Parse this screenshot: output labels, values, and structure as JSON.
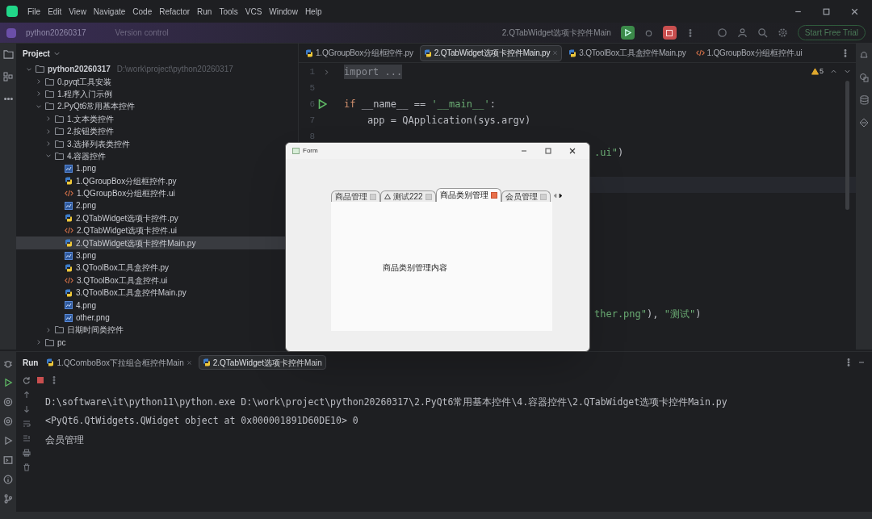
{
  "menu": [
    "File",
    "Edit",
    "View",
    "Navigate",
    "Code",
    "Refactor",
    "Run",
    "Tools",
    "VCS",
    "Window",
    "Help"
  ],
  "toolbar": {
    "project": "python20260317",
    "vcs": "Version control",
    "run_config": "2.QTabWidget选项卡控件Main",
    "trial": "Start Free Trial"
  },
  "project_panel": {
    "title": "Project",
    "tree": [
      {
        "label": "python20260317",
        "path": "D:\\work\\project\\python20260317",
        "kind": "folder",
        "expanded": true,
        "selected": false,
        "children": [
          {
            "label": "0.pyqt工具安装",
            "kind": "folder",
            "expanded": false,
            "selected": false
          },
          {
            "label": "1.程序入门示例",
            "kind": "folder",
            "expanded": false,
            "selected": false
          },
          {
            "label": "2.PyQt6常用基本控件",
            "kind": "folder",
            "expanded": true,
            "selected": false,
            "children": [
              {
                "label": "1.文本类控件",
                "kind": "folder",
                "expanded": false,
                "selected": false
              },
              {
                "label": "2.按钮类控件",
                "kind": "folder",
                "expanded": false,
                "selected": false
              },
              {
                "label": "3.选择列表类控件",
                "kind": "folder",
                "expanded": false,
                "selected": false
              },
              {
                "label": "4.容器控件",
                "kind": "folder",
                "expanded": true,
                "selected": false,
                "children": [
                  {
                    "label": "1.png",
                    "kind": "image",
                    "selected": false
                  },
                  {
                    "label": "1.QGroupBox分组框控件.py",
                    "kind": "python",
                    "selected": false
                  },
                  {
                    "label": "1.QGroupBox分组框控件.ui",
                    "kind": "ui",
                    "selected": false
                  },
                  {
                    "label": "2.png",
                    "kind": "image",
                    "selected": false
                  },
                  {
                    "label": "2.QTabWidget选项卡控件.py",
                    "kind": "python",
                    "selected": false
                  },
                  {
                    "label": "2.QTabWidget选项卡控件.ui",
                    "kind": "ui",
                    "selected": false
                  },
                  {
                    "label": "2.QTabWidget选项卡控件Main.py",
                    "kind": "python",
                    "selected": true
                  },
                  {
                    "label": "3.png",
                    "kind": "image",
                    "selected": false
                  },
                  {
                    "label": "3.QToolBox工具盒控件.py",
                    "kind": "python",
                    "selected": false
                  },
                  {
                    "label": "3.QToolBox工具盒控件.ui",
                    "kind": "ui",
                    "selected": false
                  },
                  {
                    "label": "3.QToolBox工具盒控件Main.py",
                    "kind": "python",
                    "selected": false
                  },
                  {
                    "label": "4.png",
                    "kind": "image",
                    "selected": false
                  },
                  {
                    "label": "other.png",
                    "kind": "image",
                    "selected": false
                  }
                ]
              },
              {
                "label": "日期时间类控件",
                "kind": "folder",
                "expanded": false,
                "selected": false
              }
            ]
          },
          {
            "label": "pc",
            "kind": "folder",
            "expanded": false,
            "selected": false
          }
        ]
      }
    ]
  },
  "editor_tabs": [
    {
      "label": "1.QGroupBox分组框控件.py",
      "kind": "python",
      "selected": false
    },
    {
      "label": "2.QTabWidget选项卡控件Main.py",
      "kind": "python",
      "selected": true
    },
    {
      "label": "3.QToolBox工具盒控件Main.py",
      "kind": "python",
      "selected": false
    },
    {
      "label": "1.QGroupBox分组框控件.ui",
      "kind": "ui",
      "selected": false
    }
  ],
  "warnings": "5",
  "code_lines": [
    {
      "number": "1",
      "folded": true,
      "tokens": [
        {
          "t": "import ..."
        }
      ]
    },
    {
      "number": "5"
    },
    {
      "number": "6",
      "run_marker": true,
      "tokens": [
        {
          "t": "if",
          "kind": "keyword"
        },
        {
          "t": " __name__ == ",
          "kind": "plain"
        },
        {
          "t": "'__main__'",
          "kind": "string"
        },
        {
          "t": ":",
          "kind": "plain"
        }
      ]
    },
    {
      "number": "7",
      "tokens": [
        {
          "t": "    app = QApplication(sys.argv)",
          "kind": "plain"
        }
      ]
    },
    {
      "number": "8"
    }
  ],
  "side_lines": [
    {
      "tokens": [
        {
          "t": ".ui\"",
          "kind": "string"
        },
        {
          "t": ")",
          "kind": "plain"
        }
      ]
    },
    {
      "current": true
    },
    {
      "tokens": [
        {
          "t": "ther.png\"",
          "kind": "string"
        },
        {
          "t": "), ",
          "kind": "plain"
        },
        {
          "t": "\"测试\"",
          "kind": "string"
        },
        {
          "t": ")",
          "kind": "plain"
        }
      ]
    }
  ],
  "run_panel": {
    "title": "Run",
    "tabs": [
      {
        "label": "1.QComboBox下拉组合框控件Main",
        "selected": false
      },
      {
        "label": "2.QTabWidget选项卡控件Main",
        "selected": true
      }
    ],
    "output": [
      "D:\\software\\it\\python11\\python.exe D:\\work\\project\\python20260317\\2.PyQt6常用基本控件\\4.容器控件\\2.QTabWidget选项卡控件Main.py",
      "<PyQt6.QtWidgets.QWidget object at 0x000001891D60DE10> 0",
      "会员管理"
    ]
  },
  "dialog": {
    "title": "Form",
    "tabs": [
      {
        "label": "商品管理",
        "icon": false,
        "selected": false
      },
      {
        "label": "测试222",
        "icon": true,
        "selected": false
      },
      {
        "label": "商品类别管理",
        "icon": false,
        "selected": true
      },
      {
        "label": "会员管理",
        "icon": false,
        "selected": false
      }
    ],
    "content": "商品类别管理内容"
  }
}
